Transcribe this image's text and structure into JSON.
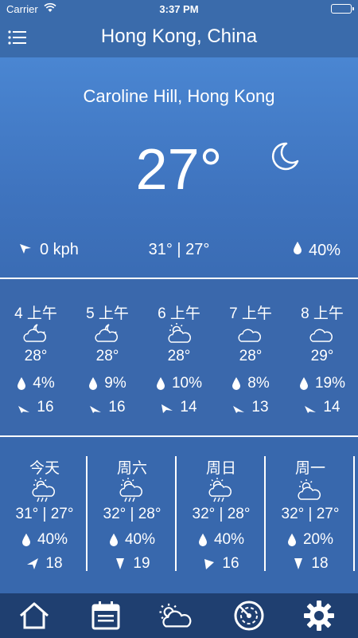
{
  "status_bar": {
    "carrier": "Carrier",
    "time": "3:37 PM"
  },
  "header": {
    "title": "Hong Kong, China"
  },
  "current": {
    "location": "Caroline Hill, Hong Kong",
    "temperature": "27°",
    "wind": "0 kph",
    "high_low": "31° | 27°",
    "humidity": "40%",
    "condition_icon": "moon-icon"
  },
  "hourly": [
    {
      "time": "4 上午",
      "icon": "partly-cloudy-night-icon",
      "temp": "28°",
      "precip": "4%",
      "wind": "16"
    },
    {
      "time": "5 上午",
      "icon": "partly-cloudy-night-icon",
      "temp": "28°",
      "precip": "9%",
      "wind": "16"
    },
    {
      "time": "6 上午",
      "icon": "partly-cloudy-day-icon",
      "temp": "28°",
      "precip": "10%",
      "wind": "14"
    },
    {
      "time": "7 上午",
      "icon": "cloudy-icon",
      "temp": "28°",
      "precip": "8%",
      "wind": "13"
    },
    {
      "time": "8 上午",
      "icon": "cloudy-icon",
      "temp": "29°",
      "precip": "19%",
      "wind": "14"
    }
  ],
  "daily": [
    {
      "day": "今天",
      "icon": "thunderstorm-icon",
      "temps": "31° | 27°",
      "precip": "40%",
      "wind": "18"
    },
    {
      "day": "周六",
      "icon": "thunderstorm-icon",
      "temps": "32° | 28°",
      "precip": "40%",
      "wind": "19"
    },
    {
      "day": "周日",
      "icon": "thunderstorm-icon",
      "temps": "32° | 28°",
      "precip": "40%",
      "wind": "16"
    },
    {
      "day": "周一",
      "icon": "partly-cloudy-day-icon",
      "temps": "32° | 27°",
      "precip": "20%",
      "wind": "18"
    }
  ],
  "tab_bar": {
    "tabs": [
      "home-icon",
      "calendar-icon",
      "weather-icon",
      "radar-icon",
      "settings-icon"
    ]
  },
  "colors": {
    "header": "#3a6bab",
    "current_top": "#4a86d2",
    "hourly_bg": "#3a68ac",
    "daily_bg": "#3868ad",
    "tab_bar": "#1f3f70"
  }
}
